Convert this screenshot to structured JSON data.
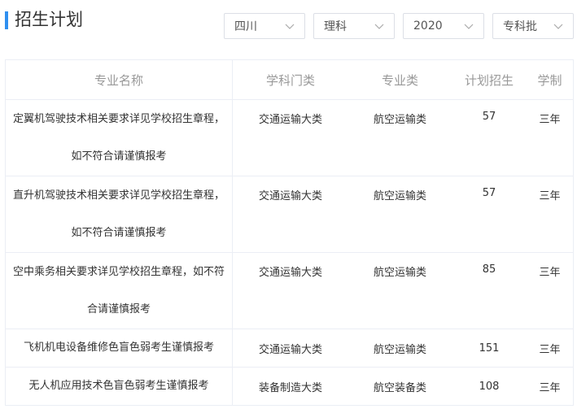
{
  "title": "招生计划",
  "filters": [
    {
      "value": "四川"
    },
    {
      "value": "理科"
    },
    {
      "value": "2020"
    },
    {
      "value": "专科批"
    }
  ],
  "table": {
    "headers": [
      "专业名称",
      "学科门类",
      "专业类",
      "计划招生",
      "学制"
    ],
    "rows": [
      {
        "name": "定翼机驾驶技术相关要求详见学校招生章程，如不符合请谨慎报考",
        "category": "交通运输大类",
        "subcategory": "航空运输类",
        "plan": "57",
        "duration": "三年"
      },
      {
        "name": "直升机驾驶技术相关要求详见学校招生章程，如不符合请谨慎报考",
        "category": "交通运输大类",
        "subcategory": "航空运输类",
        "plan": "57",
        "duration": "三年"
      },
      {
        "name": "空中乘务相关要求详见学校招生章程，如不符合请谨慎报考",
        "category": "交通运输大类",
        "subcategory": "航空运输类",
        "plan": "85",
        "duration": "三年"
      },
      {
        "name": "飞机机电设备维修色盲色弱考生谨慎报考",
        "category": "交通运输大类",
        "subcategory": "航空运输类",
        "plan": "151",
        "duration": "三年"
      },
      {
        "name": "无人机应用技术色盲色弱考生谨慎报考",
        "category": "装备制造大类",
        "subcategory": "航空装备类",
        "plan": "108",
        "duration": "三年"
      }
    ]
  }
}
